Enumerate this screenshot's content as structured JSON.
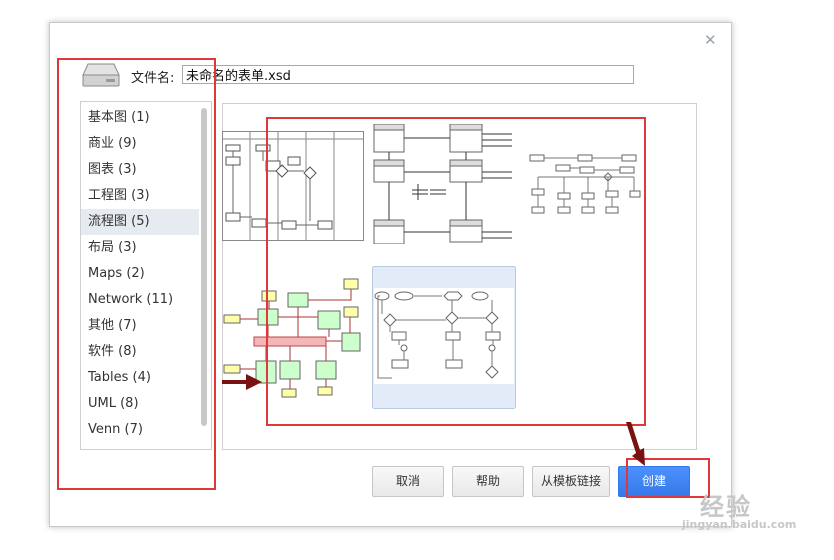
{
  "dialog": {
    "close_icon": "close-icon",
    "filename_label": "文件名:",
    "filename_value": "未命名的表单.xsd"
  },
  "categories": [
    {
      "label": "基本图 (1)"
    },
    {
      "label": "商业 (9)"
    },
    {
      "label": "图表 (3)"
    },
    {
      "label": "工程图 (3)"
    },
    {
      "label": "流程图 (5)",
      "selected": true
    },
    {
      "label": "布局 (3)"
    },
    {
      "label": "Maps (2)"
    },
    {
      "label": "Network (11)"
    },
    {
      "label": "其他 (7)"
    },
    {
      "label": "软件 (8)"
    },
    {
      "label": "Tables (4)"
    },
    {
      "label": "UML (8)"
    },
    {
      "label": "Venn (7)"
    }
  ],
  "buttons": {
    "cancel": "取消",
    "help": "帮助",
    "from_template_link": "从模板链接",
    "create": "创建"
  },
  "watermark": {
    "line1": "经验",
    "line2": "jingyan.baidu.com"
  },
  "colors": {
    "accent": "#4d90fe",
    "annotation": "#e0383a",
    "selected_bg": "#e6eaf1",
    "arrow": "#7a1212"
  }
}
